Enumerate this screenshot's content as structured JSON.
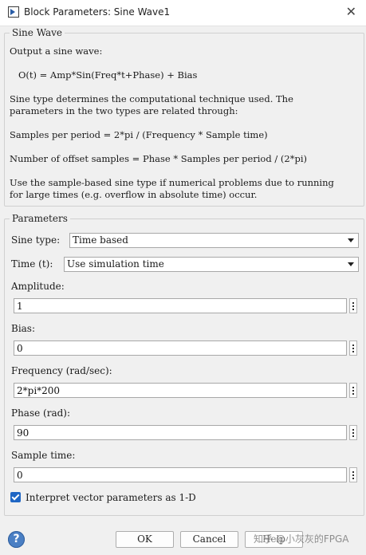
{
  "window": {
    "title": "Block Parameters: Sine Wave1",
    "icon": "simulink-block-icon",
    "close_glyph": "✕"
  },
  "sine_wave": {
    "legend": "Sine Wave",
    "lines": [
      "Output a sine wave:",
      "   O(t) = Amp*Sin(Freq*t+Phase) + Bias",
      "Sine type determines the computational technique used. The",
      "parameters in the two types are related through:",
      "Samples per period = 2*pi / (Frequency * Sample time)",
      "Number of offset samples = Phase * Samples per period / (2*pi)",
      "Use the sample-based sine type if numerical problems due to running",
      "for large times (e.g. overflow in absolute time) occur."
    ]
  },
  "parameters": {
    "legend": "Parameters",
    "sine_type": {
      "label": "Sine type:",
      "value": "Time based"
    },
    "time": {
      "label": "Time (t):",
      "value": "Use simulation time"
    },
    "amplitude": {
      "label": "Amplitude:",
      "value": "1"
    },
    "bias": {
      "label": "Bias:",
      "value": "0"
    },
    "frequency": {
      "label": "Frequency (rad/sec):",
      "value": "2*pi*200"
    },
    "phase": {
      "label": "Phase (rad):",
      "value": "90"
    },
    "sample_time": {
      "label": "Sample time:",
      "value": "0"
    },
    "interpret_vector": {
      "label": "Interpret vector parameters as 1-D",
      "checked": true
    }
  },
  "buttons": {
    "help": "?",
    "ok": "OK",
    "cancel": "Cancel",
    "help_label": "Help"
  },
  "watermark": "知乎 @小灰灰的FPGA"
}
